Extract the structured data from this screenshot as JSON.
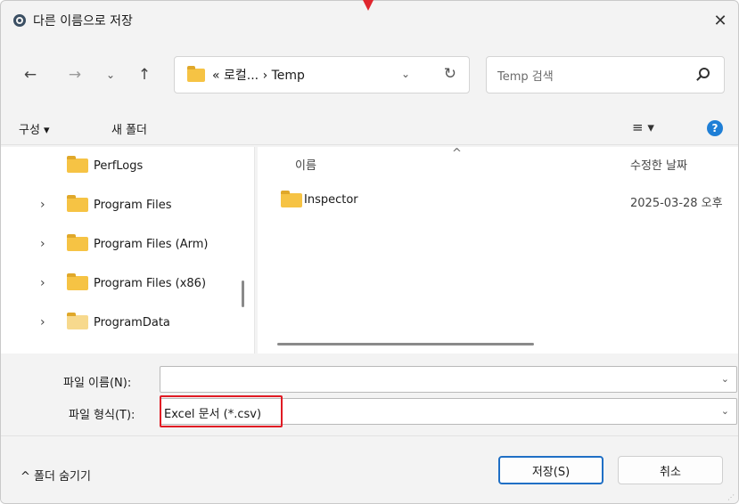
{
  "window": {
    "title": "다른 이름으로 저장",
    "close_glyph": "✕",
    "title_icon": "app-icon"
  },
  "nav": {
    "back_glyph": "←",
    "forward_glyph": "→",
    "recent_glyph": "⌄",
    "up_glyph": "↑",
    "address": "« 로컬... › Temp",
    "address_dropdown_glyph": "⌄",
    "refresh_glyph": "↻",
    "search_placeholder": "Temp 검색"
  },
  "toolbar": {
    "organize_label": "구성 ▾",
    "new_folder_label": "새 폴더",
    "view_glyph": "≡ ▾",
    "help_glyph": "?"
  },
  "tree": {
    "items": [
      {
        "label": "PerfLogs",
        "expandable": false
      },
      {
        "label": "Program Files",
        "expandable": true
      },
      {
        "label": "Program Files (Arm)",
        "expandable": true
      },
      {
        "label": "Program Files (x86)",
        "expandable": true
      },
      {
        "label": "ProgramData",
        "expandable": true
      }
    ],
    "chevron_glyph": "›"
  },
  "filelist": {
    "sort_glyph": "^",
    "columns": {
      "name": "이름",
      "date": "수정한 날짜"
    },
    "rows": [
      {
        "name": "Inspector",
        "date": "2025-03-28 오후"
      }
    ]
  },
  "form": {
    "filename_label": "파일 이름(N):",
    "filename_value": "",
    "filetype_label": "파일 형식(T):",
    "filetype_value": "Excel 문서 (*.csv)",
    "caret_glyph": "⌄",
    "highlight_color": "#e01b24"
  },
  "footer": {
    "hide_folders_label": "^ 폴더 숨기기",
    "save_label": "저장(S)",
    "cancel_label": "취소"
  },
  "colors": {
    "accent": "#1f6fc5",
    "folder": "#f6c344",
    "help": "#1f7fd6"
  }
}
